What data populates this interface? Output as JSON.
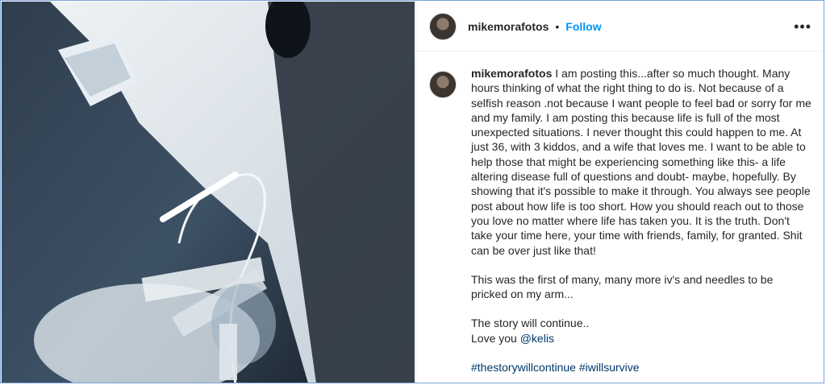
{
  "post": {
    "username": "mikemorafotos",
    "separator": "•",
    "follow_label": "Follow",
    "more_icon": "•••"
  },
  "photo": {
    "icon": "hospital-iv-photo"
  },
  "caption": {
    "username": "mikemorafotos",
    "text_1": "I am posting this...after so much thought. Many hours thinking of what the right thing to do is. Not because of a selfish reason .not because I want people to feel bad or sorry for me and my family. I am posting this because life is full of the most unexpected situations. I never thought this could happen to me. At just 36, with 3 kiddos, and a wife that loves me. I want to be able to help those that might be experiencing something like this- a life altering disease full of questions and doubt- maybe, hopefully. By showing that it's possible to make it through. You always see people post about how life is too short. How you should reach out to those you love no matter where life has taken you. It is the truth. Don't take your time here, your time with friends, family, for granted. Shit can be over just like that!",
    "text_2": "This was the first of many, many more iv's and needles to be pricked on my arm...",
    "text_3": "The story will continue..",
    "text_4_prefix": "Love you",
    "mention": "@kelis",
    "hashtag_1": "#thestorywillcontinue",
    "hashtag_2": "#iwillsurvive"
  }
}
